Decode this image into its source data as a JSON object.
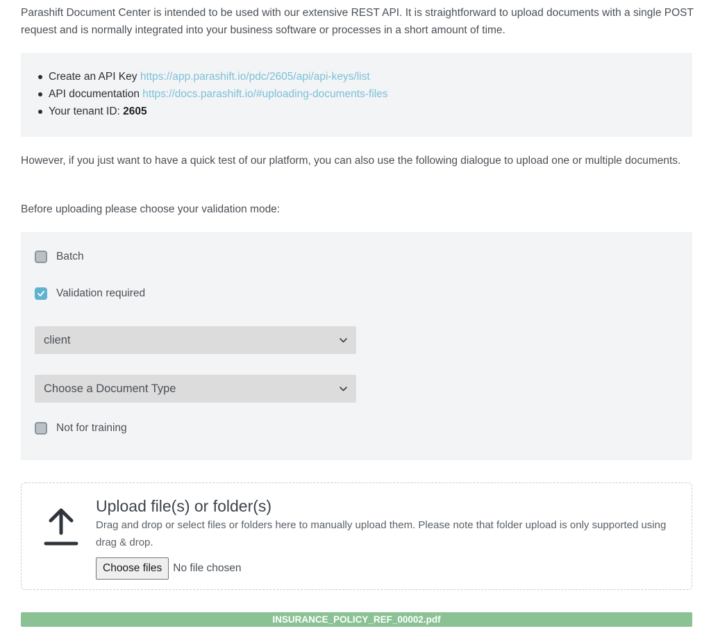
{
  "intro": {
    "text": "Parashift Document Center is intended to be used with our extensive REST API. It is straightforward to upload documents with a single POST request and is normally integrated into your business software or processes in a short amount of time."
  },
  "api_info": {
    "api_key_label": "Create an API Key ",
    "api_key_link": "https://app.parashift.io/pdc/2605/api/api-keys/list",
    "docs_label": "API documentation ",
    "docs_link": "https://docs.parashift.io/#uploading-documents-files",
    "tenant_label": "Your tenant ID: ",
    "tenant_id": "2605"
  },
  "quick_test_text": "However, if you just want to have a quick test of our platform, you can also use the following dialogue to upload one or multiple documents.",
  "validation_prompt": "Before uploading please choose your validation mode:",
  "options": {
    "batch": {
      "label": "Batch",
      "checked": false
    },
    "validation_required": {
      "label": "Validation required",
      "checked": true
    },
    "validation_select": {
      "value": "client"
    },
    "document_type_select": {
      "value": "Choose a Document Type"
    },
    "not_for_training": {
      "label": "Not for training",
      "checked": false
    }
  },
  "upload": {
    "title": "Upload file(s) or folder(s)",
    "description": "Drag and drop or select files or folders here to manually upload them. Please note that folder upload is only supported using drag & drop.",
    "choose_button": "Choose files",
    "no_file": "No file chosen"
  },
  "progress": {
    "filename": "INSURANCE_POLICY_REF_00002.pdf",
    "fraction": 1.0,
    "color": "#8bc294"
  },
  "colors": {
    "link": "#7cc0d8",
    "checkbox_checked": "#5fb3d0",
    "panel_background": "#f3f4f6"
  },
  "icons": {
    "upload": "upload-arrow-icon",
    "chevron": "chevron-down-icon",
    "check": "checkmark-icon"
  }
}
